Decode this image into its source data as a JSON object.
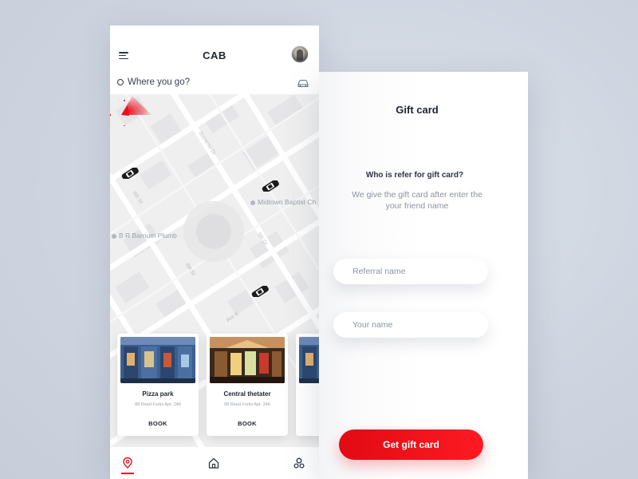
{
  "left_screen": {
    "header": {
      "title": "CAB"
    },
    "search": {
      "placeholder": "Where you go?"
    },
    "map": {
      "labels": {
        "poi_church": "Midtown Baptist Ch",
        "poi_barnum": "B R Barnum Plumb"
      }
    },
    "places": [
      {
        "name": "Pizza park",
        "address": "88 Reed Forks Apt. 246",
        "action": "BOOK"
      },
      {
        "name": "Central thetater",
        "address": "88 Reed Forks Apt. 246",
        "action": "BOOK"
      }
    ],
    "bottom_nav": [
      {
        "icon": "location-pin-icon",
        "active": true
      },
      {
        "icon": "home-icon",
        "active": false
      },
      {
        "icon": "users-icon",
        "active": false
      }
    ]
  },
  "right_screen": {
    "title": "Gift card",
    "question": "Who is refer for gift card?",
    "description": "We give the gift card after enter the your friend name",
    "fields": {
      "referral_placeholder": "Referral name",
      "name_placeholder": "Your name"
    },
    "submit_label": "Get gift card"
  },
  "colors": {
    "accent": "#e8101c",
    "text_dark": "#1d2331",
    "text_muted": "#8a93a3",
    "background": "#cdd3df",
    "map_bg": "#efefef"
  }
}
